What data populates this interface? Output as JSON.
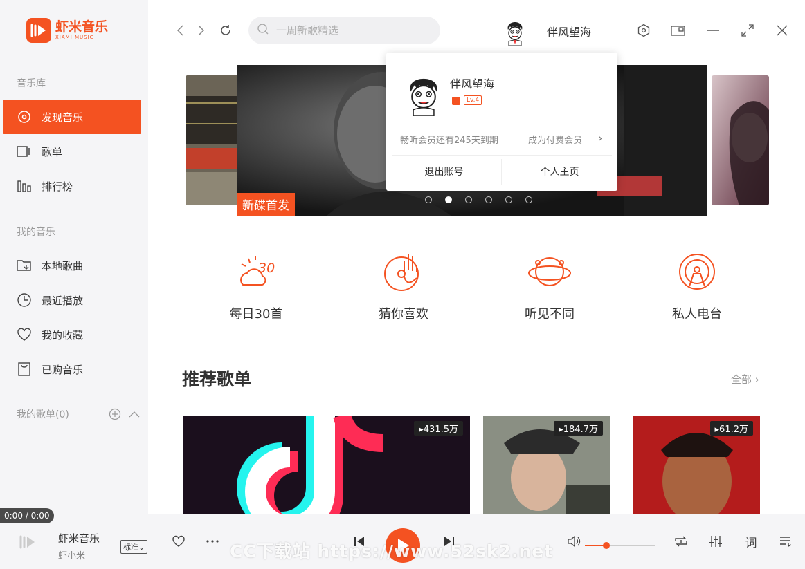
{
  "app": {
    "name_cn": "虾米音乐",
    "name_en": "XIAMI MUSIC",
    "brand_color": "#f45221"
  },
  "sidebar": {
    "section_library": "音乐库",
    "library_items": [
      {
        "label": "发现音乐",
        "icon": "disc-icon",
        "active": true
      },
      {
        "label": "歌单",
        "icon": "playlist-icon"
      },
      {
        "label": "排行榜",
        "icon": "chart-icon"
      }
    ],
    "section_my": "我的音乐",
    "my_items": [
      {
        "label": "本地歌曲",
        "icon": "folder-download-icon"
      },
      {
        "label": "最近播放",
        "icon": "clock-icon"
      },
      {
        "label": "我的收藏",
        "icon": "heart-icon"
      },
      {
        "label": "已购音乐",
        "icon": "bag-icon"
      }
    ],
    "playlists_label": "我的歌单(0)"
  },
  "topbar": {
    "search_placeholder": "一周新歌精选",
    "username": "伴风望海"
  },
  "banner": {
    "badge": "新碟首发",
    "active_dot": 1,
    "dot_count": 6
  },
  "user_popover": {
    "username": "伴风望海",
    "level": "Lv.4",
    "membership_text": "畅听会员还有245天到期",
    "upgrade_link": "成为付费会员",
    "logout": "退出账号",
    "profile": "个人主页"
  },
  "features": [
    {
      "label": "每日30首",
      "icon": "daily-30-icon"
    },
    {
      "label": "猜你喜欢",
      "icon": "rock-hand-icon"
    },
    {
      "label": "听见不同",
      "icon": "planet-icon"
    },
    {
      "label": "私人电台",
      "icon": "radio-icon"
    }
  ],
  "recommended": {
    "title": "推荐歌单",
    "more": "全部",
    "cards": [
      {
        "plays": "431.5万"
      },
      {
        "plays": "184.7万"
      },
      {
        "plays": "61.2万"
      }
    ]
  },
  "player": {
    "time": "0:00 / 0:00",
    "song": "虾米音乐",
    "artist": "虾小米",
    "quality": "标准",
    "volume": 0.3,
    "lyrics_label": "词"
  },
  "watermark": "CC下载站 https://www.52sk2.net"
}
